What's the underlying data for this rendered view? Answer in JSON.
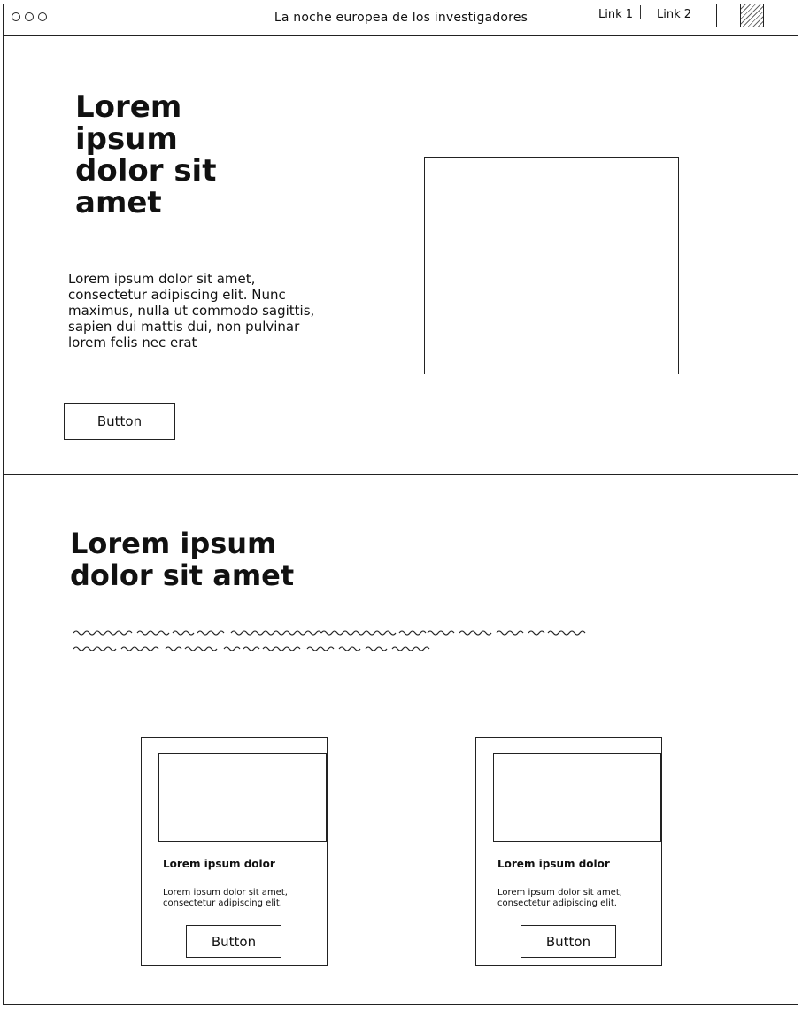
{
  "window": {
    "title": "La noche europea de los investigadores",
    "nav_links": [
      "Link 1",
      "Link 2"
    ]
  },
  "hero": {
    "heading": "Lorem ipsum dolor sit amet",
    "description": "Lorem ipsum dolor sit amet, consectetur adipiscing elit. Nunc maximus, nulla ut commodo sagittis, sapien dui mattis dui, non pulvinar lorem felis nec erat",
    "button_label": "Button"
  },
  "section": {
    "heading": "Lorem ipsum dolor sit amet",
    "cards": [
      {
        "title": "Lorem ipsum dolor",
        "text": "Lorem ipsum dolor sit amet, consectetur adipiscing elit.",
        "button_label": "Button"
      },
      {
        "title": "Lorem ipsum dolor",
        "text": "Lorem ipsum dolor sit amet, consectetur adipiscing elit.",
        "button_label": "Button"
      }
    ]
  }
}
